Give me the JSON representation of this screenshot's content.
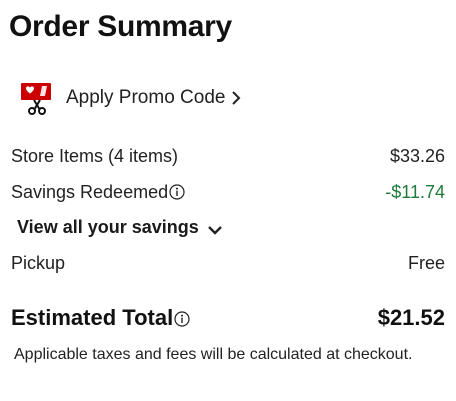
{
  "header": {
    "title": "Order Summary"
  },
  "promo": {
    "label": "Apply Promo Code",
    "icon": "coupon-scissors-icon",
    "accent_color": "#cc0000"
  },
  "summary": {
    "store_items_label": "Store Items (4 items)",
    "store_items_value": "$33.26",
    "savings_label": "Savings Redeemed",
    "savings_value": "-$11.74",
    "savings_color": "#1e7b3c",
    "view_savings_label": "View all your savings",
    "pickup_label": "Pickup",
    "pickup_value": "Free"
  },
  "total": {
    "label": "Estimated Total",
    "value": "$21.52"
  },
  "note": {
    "text": "Applicable taxes and fees will be calculated at checkout."
  }
}
